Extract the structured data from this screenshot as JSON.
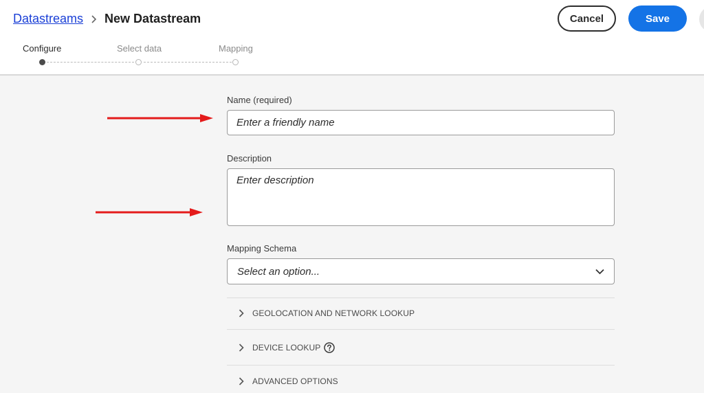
{
  "breadcrumb": {
    "parent": "Datastreams",
    "current": "New Datastream"
  },
  "actions": {
    "cancel_label": "Cancel",
    "save_label": "Save"
  },
  "steps": [
    {
      "label": "Configure",
      "state": "active"
    },
    {
      "label": "Select data",
      "state": "inactive"
    },
    {
      "label": "Mapping",
      "state": "inactive"
    }
  ],
  "form": {
    "name_label": "Name (required)",
    "name_placeholder": "Enter a friendly name",
    "description_label": "Description",
    "description_placeholder": "Enter description",
    "schema_label": "Mapping Schema",
    "schema_value": "Select an option..."
  },
  "sections": [
    {
      "label": "GEOLOCATION AND NETWORK LOOKUP",
      "has_help": false
    },
    {
      "label": "DEVICE LOOKUP",
      "has_help": true
    },
    {
      "label": "ADVANCED OPTIONS",
      "has_help": false
    }
  ],
  "icons": {
    "breadcrumb_separator": "chevron-right-icon",
    "select_toggle": "chevron-down-icon",
    "section_expand": "chevron-right-icon",
    "help": "question-circle-icon",
    "annotation": "red-arrow-icon"
  },
  "colors": {
    "primary": "#1473e6",
    "link": "#1a3fd6",
    "annotation_arrow": "#e41b1b"
  }
}
